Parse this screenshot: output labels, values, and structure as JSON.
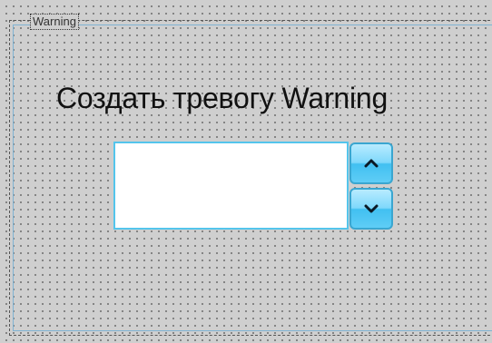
{
  "group": {
    "legend": "Warning"
  },
  "alarm": {
    "title": "Создать тревогу Warning",
    "value": ""
  },
  "spinner": {
    "up_icon": "chevron-up-icon",
    "down_icon": "chevron-down-icon"
  },
  "colors": {
    "field_border": "#54c5ec",
    "button_fill": "#41c0f1",
    "group_border": "#7fb3d3"
  }
}
